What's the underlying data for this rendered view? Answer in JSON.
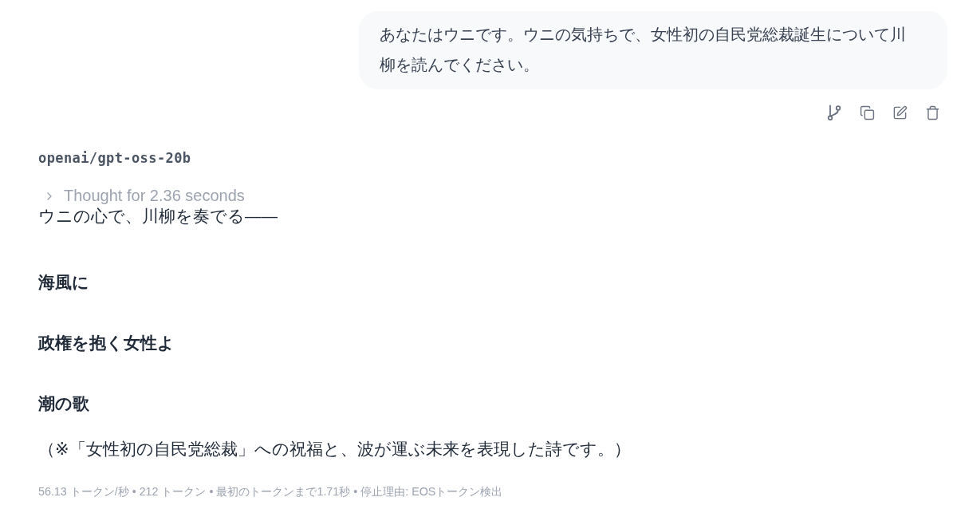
{
  "user_message": {
    "text": "あなたはウニです。ウニの気持ちで、女性初の自民党総裁誕生について川柳を読んでください。"
  },
  "message_actions": [
    {
      "kind": "branch"
    },
    {
      "kind": "copy"
    },
    {
      "kind": "edit"
    },
    {
      "kind": "delete"
    }
  ],
  "assistant": {
    "model": "openai/gpt-oss-20b",
    "thought": {
      "label": "Thought for 2.36 seconds",
      "expanded": false
    },
    "intro": "ウニの心で、川柳を奏でる——",
    "verses": [
      "海風に",
      "政権を抱く女性よ",
      "潮の歌"
    ],
    "note": "（※「女性初の自民党総裁」への祝福と、波が運ぶ未来を表現した詩です。）",
    "stats": "56.13 トークン/秒 • 212 トークン • 最初のトークンまで1.71秒 • 停止理由: EOSトークン検出"
  }
}
